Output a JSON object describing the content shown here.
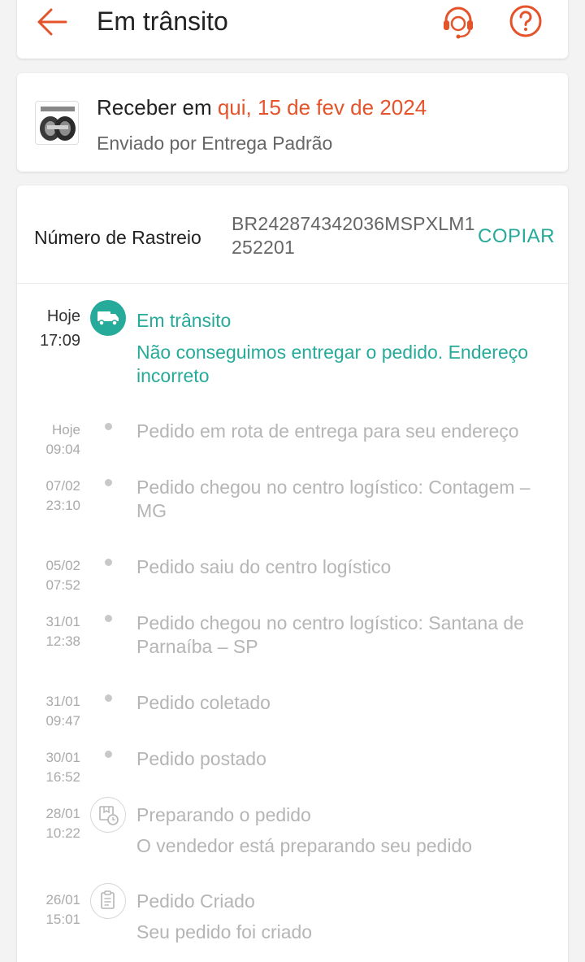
{
  "header": {
    "title": "Em trânsito"
  },
  "delivery": {
    "prefix": "Receber em ",
    "date": "qui, 15 de fev de 2024",
    "shipping_method": "Enviado por Entrega Padrão"
  },
  "tracking": {
    "label": "Número de Rastreio",
    "number": "BR242874342036MSPXLM1252201",
    "copy_label": "COPIAR"
  },
  "events": [
    {
      "day": "Hoje",
      "time": "17:09",
      "title": "Em trânsito",
      "description": "Não conseguimos entregar o pedido. Endereço incorreto"
    },
    {
      "day": "Hoje",
      "time": "09:04",
      "title": "Pedido em rota de entrega para seu endereço"
    },
    {
      "day": "07/02",
      "time": "23:10",
      "title": "Pedido chegou no centro logístico: Contagem – MG"
    },
    {
      "day": "05/02",
      "time": "07:52",
      "title": "Pedido saiu do centro logístico"
    },
    {
      "day": "31/01",
      "time": "12:38",
      "title": "Pedido chegou no centro logístico: Santana de Parnaíba – SP"
    },
    {
      "day": "31/01",
      "time": "09:47",
      "title": "Pedido coletado"
    },
    {
      "day": "30/01",
      "time": "16:52",
      "title": "Pedido postado"
    },
    {
      "day": "28/01",
      "time": "10:22",
      "title": "Preparando o pedido",
      "description": "O vendedor está preparando seu pedido"
    },
    {
      "day": "26/01",
      "time": "15:01",
      "title": "Pedido Criado",
      "description": "Seu pedido foi criado"
    }
  ],
  "icons": {
    "back": "arrow-left-icon",
    "support": "headset-icon",
    "help": "question-icon",
    "in_transit": "truck-icon",
    "preparing": "package-clock-icon",
    "created": "clipboard-icon"
  },
  "colors": {
    "accent": "#e4532a",
    "teal": "#26aa99",
    "muted": "#b5b5b5"
  }
}
